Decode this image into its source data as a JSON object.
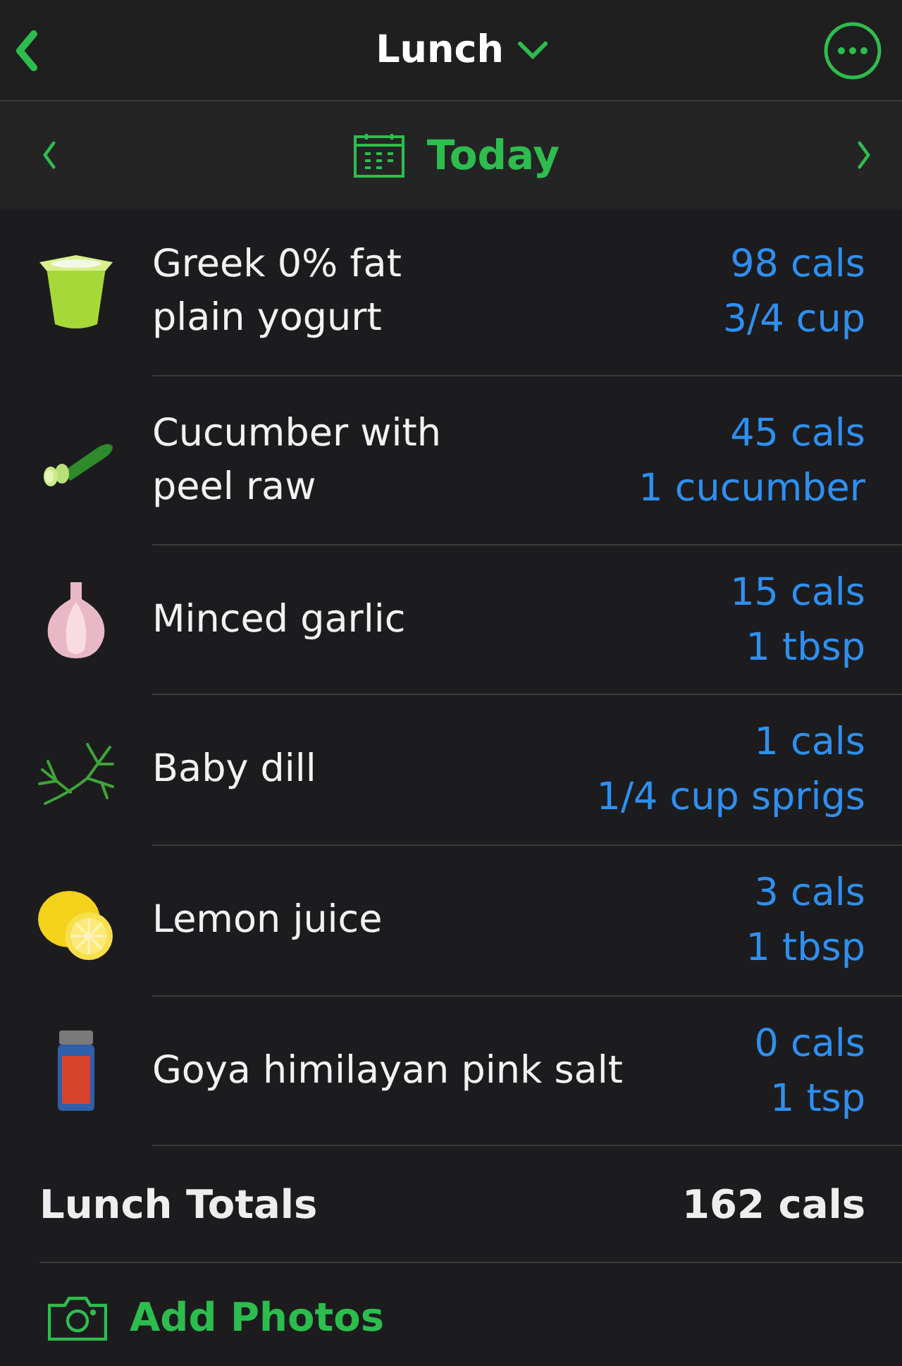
{
  "header": {
    "title": "Lunch"
  },
  "date_bar": {
    "label": "Today"
  },
  "foods": [
    {
      "kind": "yogurt",
      "name": "Greek 0% fat plain yogurt",
      "cals": "98 cals",
      "serving": "3/4 cup"
    },
    {
      "kind": "cucumber",
      "name": "Cucumber with peel raw",
      "cals": "45 cals",
      "serving": "1 cucumber"
    },
    {
      "kind": "garlic",
      "name": "Minced garlic",
      "cals": "15 cals",
      "serving": "1 tbsp"
    },
    {
      "kind": "dill",
      "name": "Baby dill",
      "cals": "1 cals",
      "serving": "1/4 cup sprigs"
    },
    {
      "kind": "lemon",
      "name": "Lemon juice",
      "cals": "3 cals",
      "serving": "1 tbsp"
    },
    {
      "kind": "salt",
      "name": "Goya himilayan pink salt",
      "cals": "0 cals",
      "serving": "1 tsp"
    }
  ],
  "totals": {
    "label": "Lunch Totals",
    "value": "162 cals"
  },
  "add_photos": {
    "label": "Add Photos"
  }
}
